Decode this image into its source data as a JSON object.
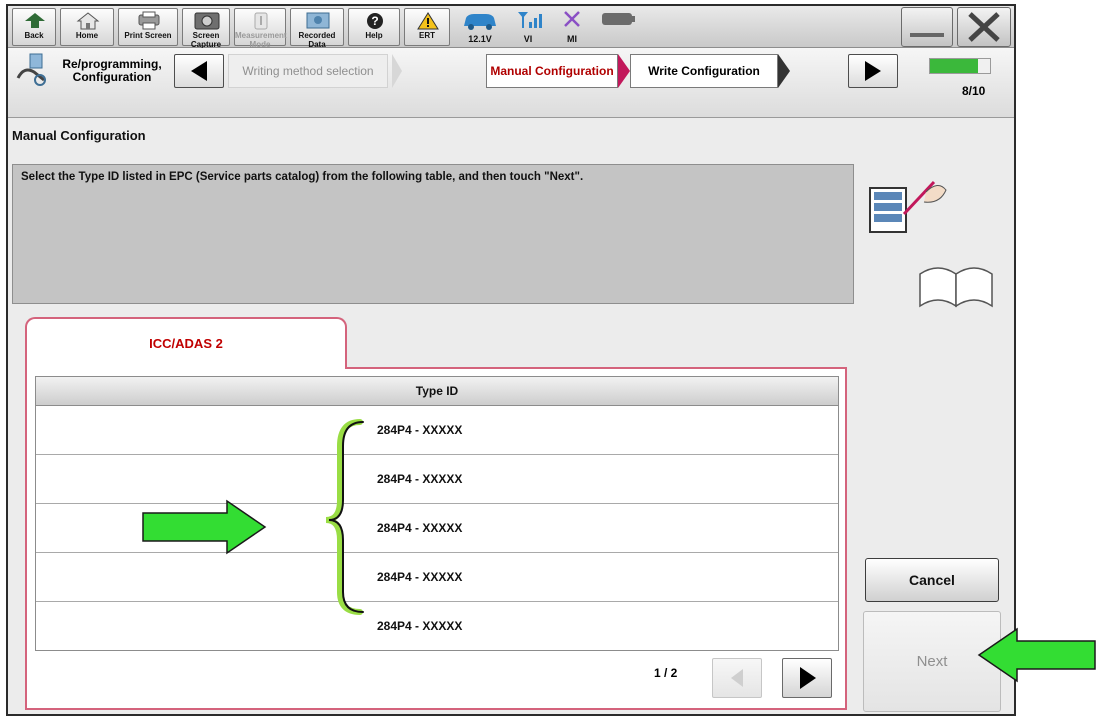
{
  "toolbar": {
    "buttons": [
      {
        "label": "Back"
      },
      {
        "label": "Home"
      },
      {
        "label": "Print Screen"
      },
      {
        "label": "Screen Capture"
      },
      {
        "label": "Measurement Mode"
      },
      {
        "label": "Recorded Data"
      },
      {
        "label": "Help"
      },
      {
        "label": "ERT"
      }
    ],
    "status": {
      "voltage": "12.1V",
      "vi": "VI",
      "mi": "MI"
    }
  },
  "steps": {
    "current_section": "Re/programming, Configuration",
    "prev_step": "Writing method selection",
    "active_step": "Manual Configuration",
    "next_step": "Write Configuration",
    "progress_text": "8/10",
    "progress_fraction": 0.8
  },
  "page": {
    "title": "Manual Configuration",
    "instruction": "Select the Type ID listed in EPC (Service parts catalog) from the following table, and then touch \"Next\"."
  },
  "tab": {
    "label": "ICC/ADAS 2"
  },
  "table": {
    "header": "Type ID",
    "rows": [
      "284P4 - XXXXX",
      "284P4 - XXXXX",
      "284P4 - XXXXX",
      "284P4 - XXXXX",
      "284P4 - XXXXX"
    ]
  },
  "pager": {
    "text": "1 / 2"
  },
  "actions": {
    "cancel_label": "Cancel",
    "next_label": "Next"
  },
  "colors": {
    "accent": "#c00000",
    "tab_border": "#d4637c",
    "annotation": "#33cc33",
    "brace": "#99dd44"
  }
}
